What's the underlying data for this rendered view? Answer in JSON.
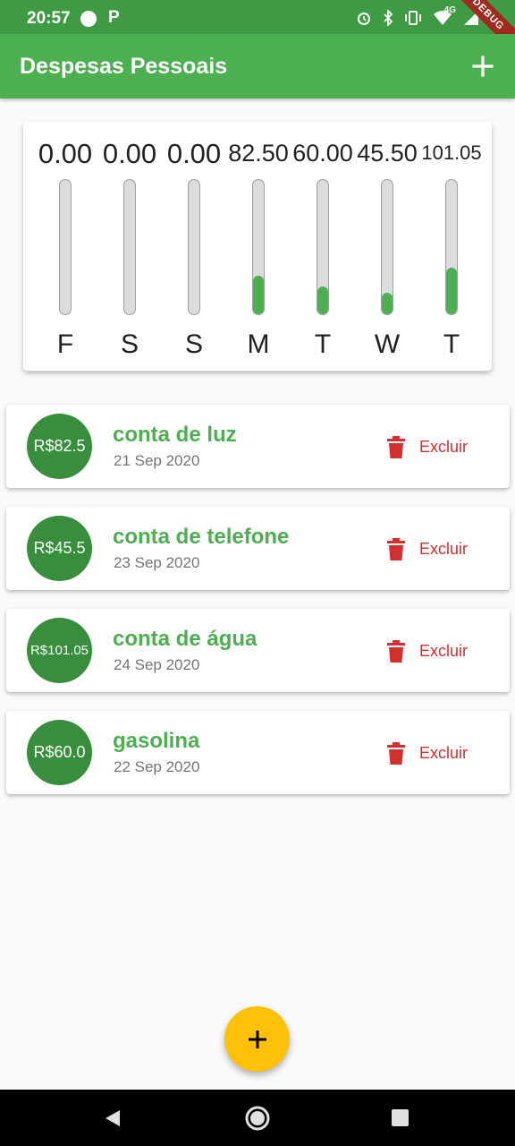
{
  "status_bar": {
    "time": "20:57",
    "badge": "P",
    "network": "4G",
    "ribbon": "DEBUG"
  },
  "app_bar": {
    "title": "Despesas Pessoais",
    "add_icon": "plus-icon"
  },
  "chart": {
    "bar_color": "#4caf50",
    "columns": [
      {
        "value_label": "0.00",
        "day": "F"
      },
      {
        "value_label": "0.00",
        "day": "S"
      },
      {
        "value_label": "0.00",
        "day": "S"
      },
      {
        "value_label": "82.50",
        "day": "M"
      },
      {
        "value_label": "60.00",
        "day": "T"
      },
      {
        "value_label": "45.50",
        "day": "W"
      },
      {
        "value_label": "101.05",
        "day": "T"
      }
    ]
  },
  "chart_data": {
    "type": "bar",
    "categories": [
      "F",
      "S",
      "S",
      "M",
      "T",
      "W",
      "T"
    ],
    "values": [
      0.0,
      0.0,
      0.0,
      82.5,
      60.0,
      45.5,
      101.05
    ],
    "title": "",
    "xlabel": "",
    "ylabel": "",
    "ylim": [
      0,
      289.05
    ],
    "grid": false
  },
  "transactions": [
    {
      "amount": "R$82.5",
      "title": "conta de luz",
      "date": "21 Sep 2020",
      "delete_label": "Excluir"
    },
    {
      "amount": "R$45.5",
      "title": "conta de telefone",
      "date": "23 Sep 2020",
      "delete_label": "Excluir"
    },
    {
      "amount": "R$101.05",
      "title": "conta de água",
      "date": "24 Sep 2020",
      "delete_label": "Excluir"
    },
    {
      "amount": "R$60.0",
      "title": "gasolina",
      "date": "22 Sep 2020",
      "delete_label": "Excluir"
    }
  ],
  "colors": {
    "primary": "#4caf50",
    "primary_dark": "#388e3c",
    "accent": "#ffc107",
    "danger": "#d32f2f"
  }
}
